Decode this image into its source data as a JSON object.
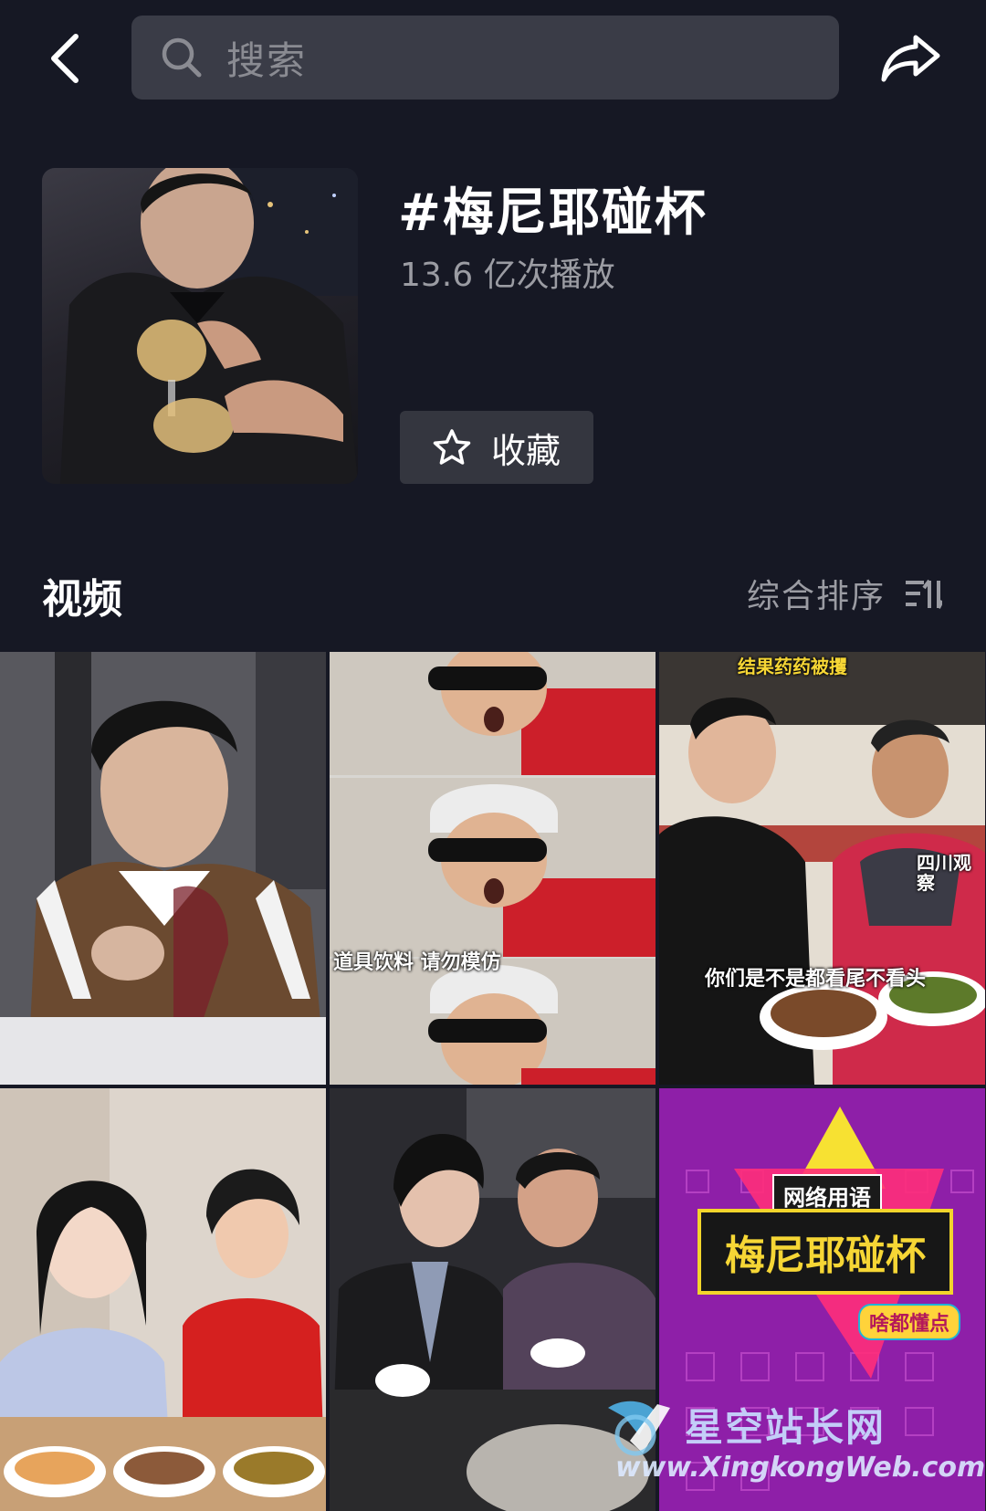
{
  "header": {
    "search_placeholder": "搜索",
    "back_icon": "chevron-left-icon",
    "share_icon": "share-arrow-icon"
  },
  "topic": {
    "title": "#梅尼耶碰杯",
    "play_count": "13.6 亿次播放",
    "favorite_label": "收藏"
  },
  "videos_section": {
    "title": "视频",
    "sort_label": "综合排序"
  },
  "videos": [
    {
      "caption": ""
    },
    {
      "caption": "道具饮料 请勿模仿"
    },
    {
      "caption": "你们是不是都看尾不看头",
      "top_text": "结果药药被攫",
      "corner_text": "四川观察"
    },
    {
      "caption": ""
    },
    {
      "caption": ""
    },
    {
      "badge": "网络用语",
      "title": "梅尼耶碰杯",
      "tag": "啥都懂点"
    }
  ],
  "watermark": {
    "name": "星空站长网",
    "url": "www.XingkongWeb.com"
  },
  "colors": {
    "background": "#161824",
    "search_bg": "#3a3c47",
    "button_bg": "#34363f",
    "secondary_text": "#9b9ca3"
  }
}
